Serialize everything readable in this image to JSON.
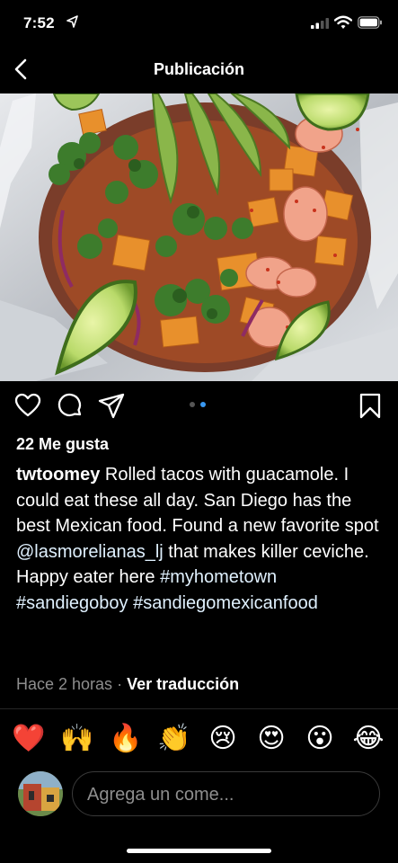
{
  "status_bar": {
    "time": "7:52"
  },
  "nav": {
    "title": "Publicación"
  },
  "post": {
    "likes": "22 Me gusta",
    "username": "twtoomey",
    "caption_intro": " Rolled tacos with guacamole. I could eat these all day. San Diego has the best Mexican food. Found a new favorite spot ",
    "mention": "@lasmorelianas_lj",
    "caption_after_mention": " that makes killer ceviche. Happy eater here ",
    "hashtags": [
      "#myhometown",
      "#sandiegoboy",
      "#sandiegomexicanfood"
    ],
    "time_ago": "Hace 2 horas",
    "separator": " · ",
    "translate": "Ver traducción"
  },
  "carousel": {
    "active_index": 2,
    "count": 2
  },
  "quick_reactions": [
    "❤️",
    "🙌",
    "🔥",
    "👏",
    "😢",
    "😍",
    "😮",
    "😂"
  ],
  "comment_box": {
    "placeholder": "Agrega un come..."
  },
  "icons": {
    "back": "chevron-left-icon",
    "like": "heart-icon",
    "comment": "comment-bubble-icon",
    "share": "paper-plane-icon",
    "save": "bookmark-icon"
  },
  "colors": {
    "background": "#000000",
    "link": "#e0f1ff",
    "muted": "#8e8e8e",
    "active_dot": "#3897f0"
  }
}
